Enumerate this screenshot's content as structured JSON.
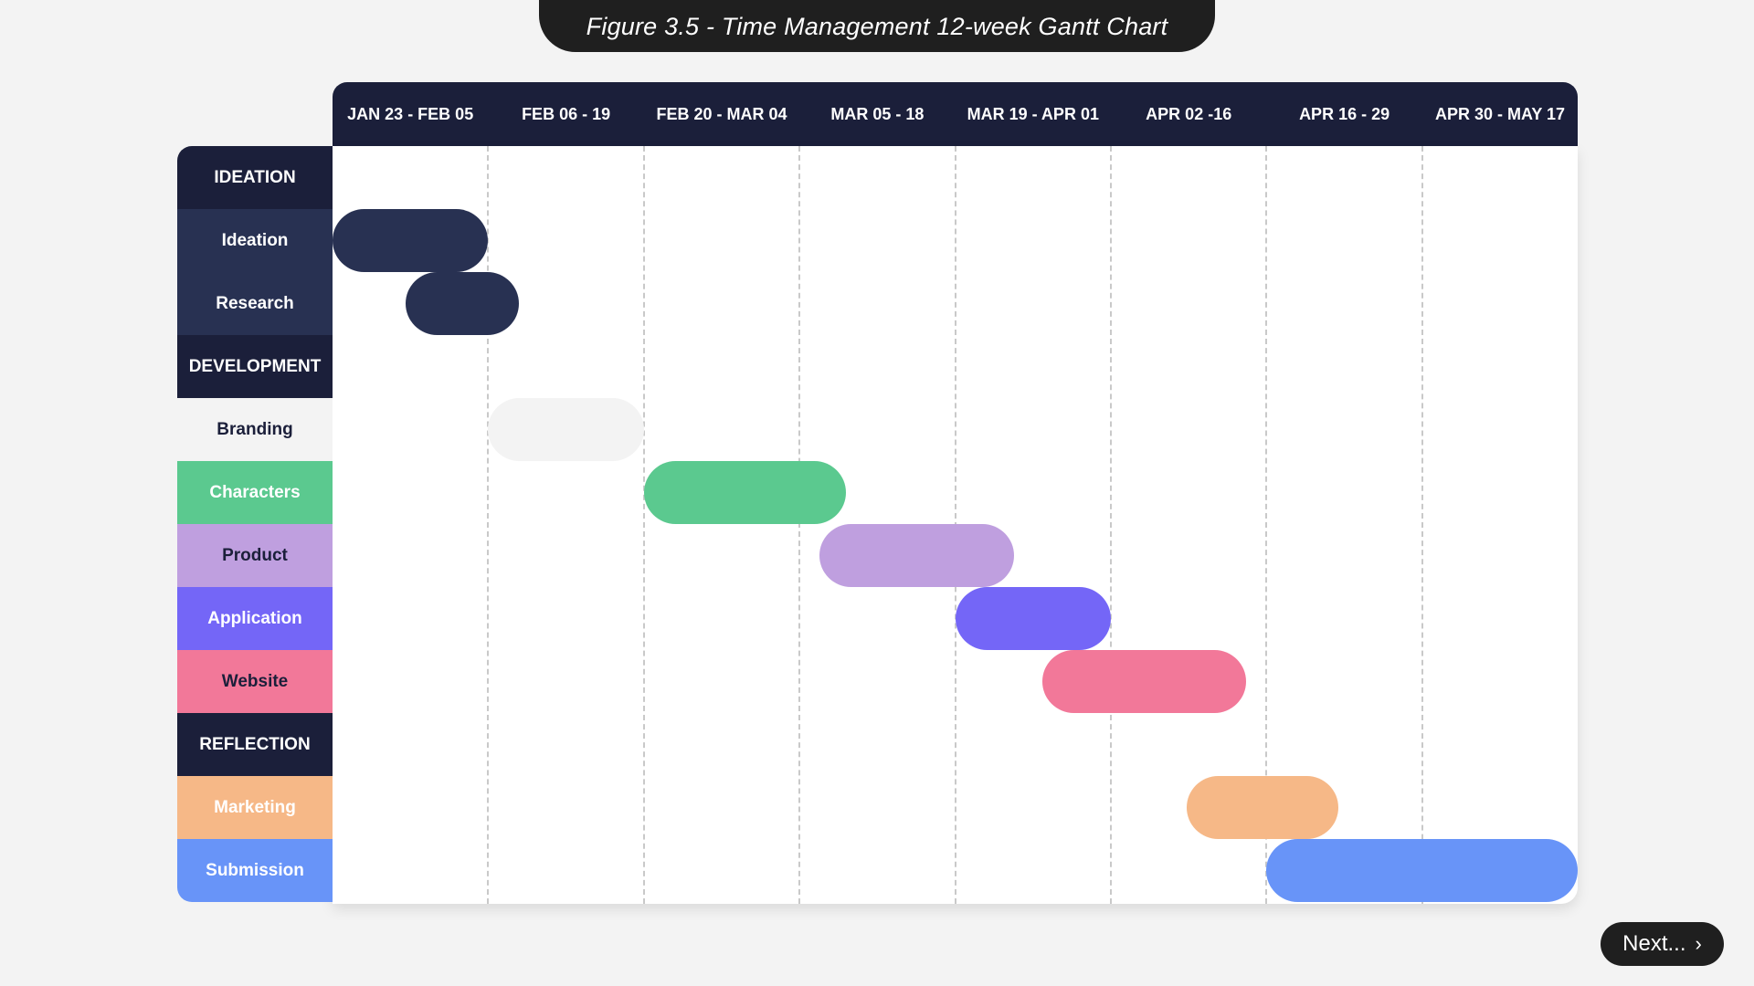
{
  "title": "Figure 3.5 - Time Management 12-week Gantt Chart",
  "next_button": {
    "label": "Next...",
    "icon": "chevron-right-icon",
    "glyph": "›"
  },
  "chart_data": {
    "type": "gantt",
    "title": "Figure 3.5 - Time Management 12-week Gantt Chart",
    "columns": [
      "JAN 23 - FEB 05",
      "FEB 06 - 19",
      "FEB 20 - MAR 04",
      "MAR 05 - 18",
      "MAR 19 - APR 01",
      "APR 02 -16",
      "APR 16 - 29",
      "APR 30 - MAY 17"
    ],
    "rows": [
      {
        "label": "IDEATION",
        "kind": "section",
        "bg": "#1b1f3a",
        "fg": "#ffffff"
      },
      {
        "label": "Ideation",
        "kind": "task",
        "bg": "#283152",
        "fg": "#ffffff",
        "bar_color": "#283152",
        "start": 0,
        "end": 1
      },
      {
        "label": "Research",
        "kind": "task",
        "bg": "#283152",
        "fg": "#ffffff",
        "bar_color": "#283152",
        "start": 0.47,
        "end": 1.2
      },
      {
        "label": "DEVELOPMENT",
        "kind": "section",
        "bg": "#1b1f3a",
        "fg": "#ffffff"
      },
      {
        "label": "Branding",
        "kind": "task",
        "bg": "#f3f3f3",
        "fg": "#1b1f3a",
        "bar_color": "#f3f3f3",
        "start": 1,
        "end": 2
      },
      {
        "label": "Characters",
        "kind": "task",
        "bg": "#5bc98f",
        "fg": "#ffffff",
        "bar_color": "#5bc98f",
        "start": 2,
        "end": 3.3
      },
      {
        "label": "Product",
        "kind": "task",
        "bg": "#bf9fdf",
        "fg": "#1b1f3a",
        "bar_color": "#bf9fdf",
        "start": 3.13,
        "end": 4.38
      },
      {
        "label": "Application",
        "kind": "task",
        "bg": "#7466f7",
        "fg": "#ffffff",
        "bar_color": "#7466f7",
        "start": 4,
        "end": 5
      },
      {
        "label": "Website",
        "kind": "task",
        "bg": "#f27899",
        "fg": "#1b1f3a",
        "bar_color": "#f27899",
        "start": 4.56,
        "end": 5.87
      },
      {
        "label": "REFLECTION",
        "kind": "section",
        "bg": "#1b1f3a",
        "fg": "#ffffff"
      },
      {
        "label": "Marketing",
        "kind": "task",
        "bg": "#f6b887",
        "fg": "#ffffff",
        "bar_color": "#f6b887",
        "start": 5.49,
        "end": 6.46
      },
      {
        "label": "Submission",
        "kind": "task",
        "bg": "#6894f8",
        "fg": "#ffffff",
        "bar_color": "#6894f8",
        "start": 6,
        "end": 8
      }
    ]
  }
}
